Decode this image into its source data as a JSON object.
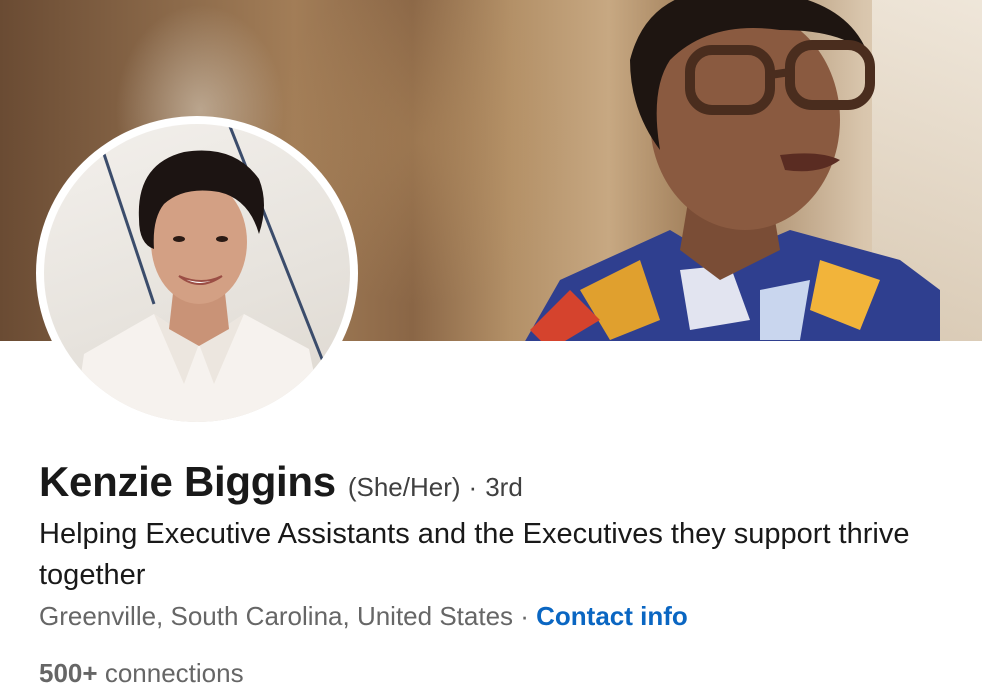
{
  "profile": {
    "name": "Kenzie Biggins",
    "pronouns": "(She/Her)",
    "degree_separator": "·",
    "degree": "3rd",
    "headline": "Helping Executive Assistants and the Executives they support thrive together",
    "location": "Greenville, South Carolina, United States",
    "location_separator": " · ",
    "contact_info_label": "Contact info",
    "connections_count": "500+",
    "connections_label": "connections"
  },
  "colors": {
    "link": "#0a66c2",
    "primary_text": "#191919",
    "secondary_text": "#666666"
  }
}
